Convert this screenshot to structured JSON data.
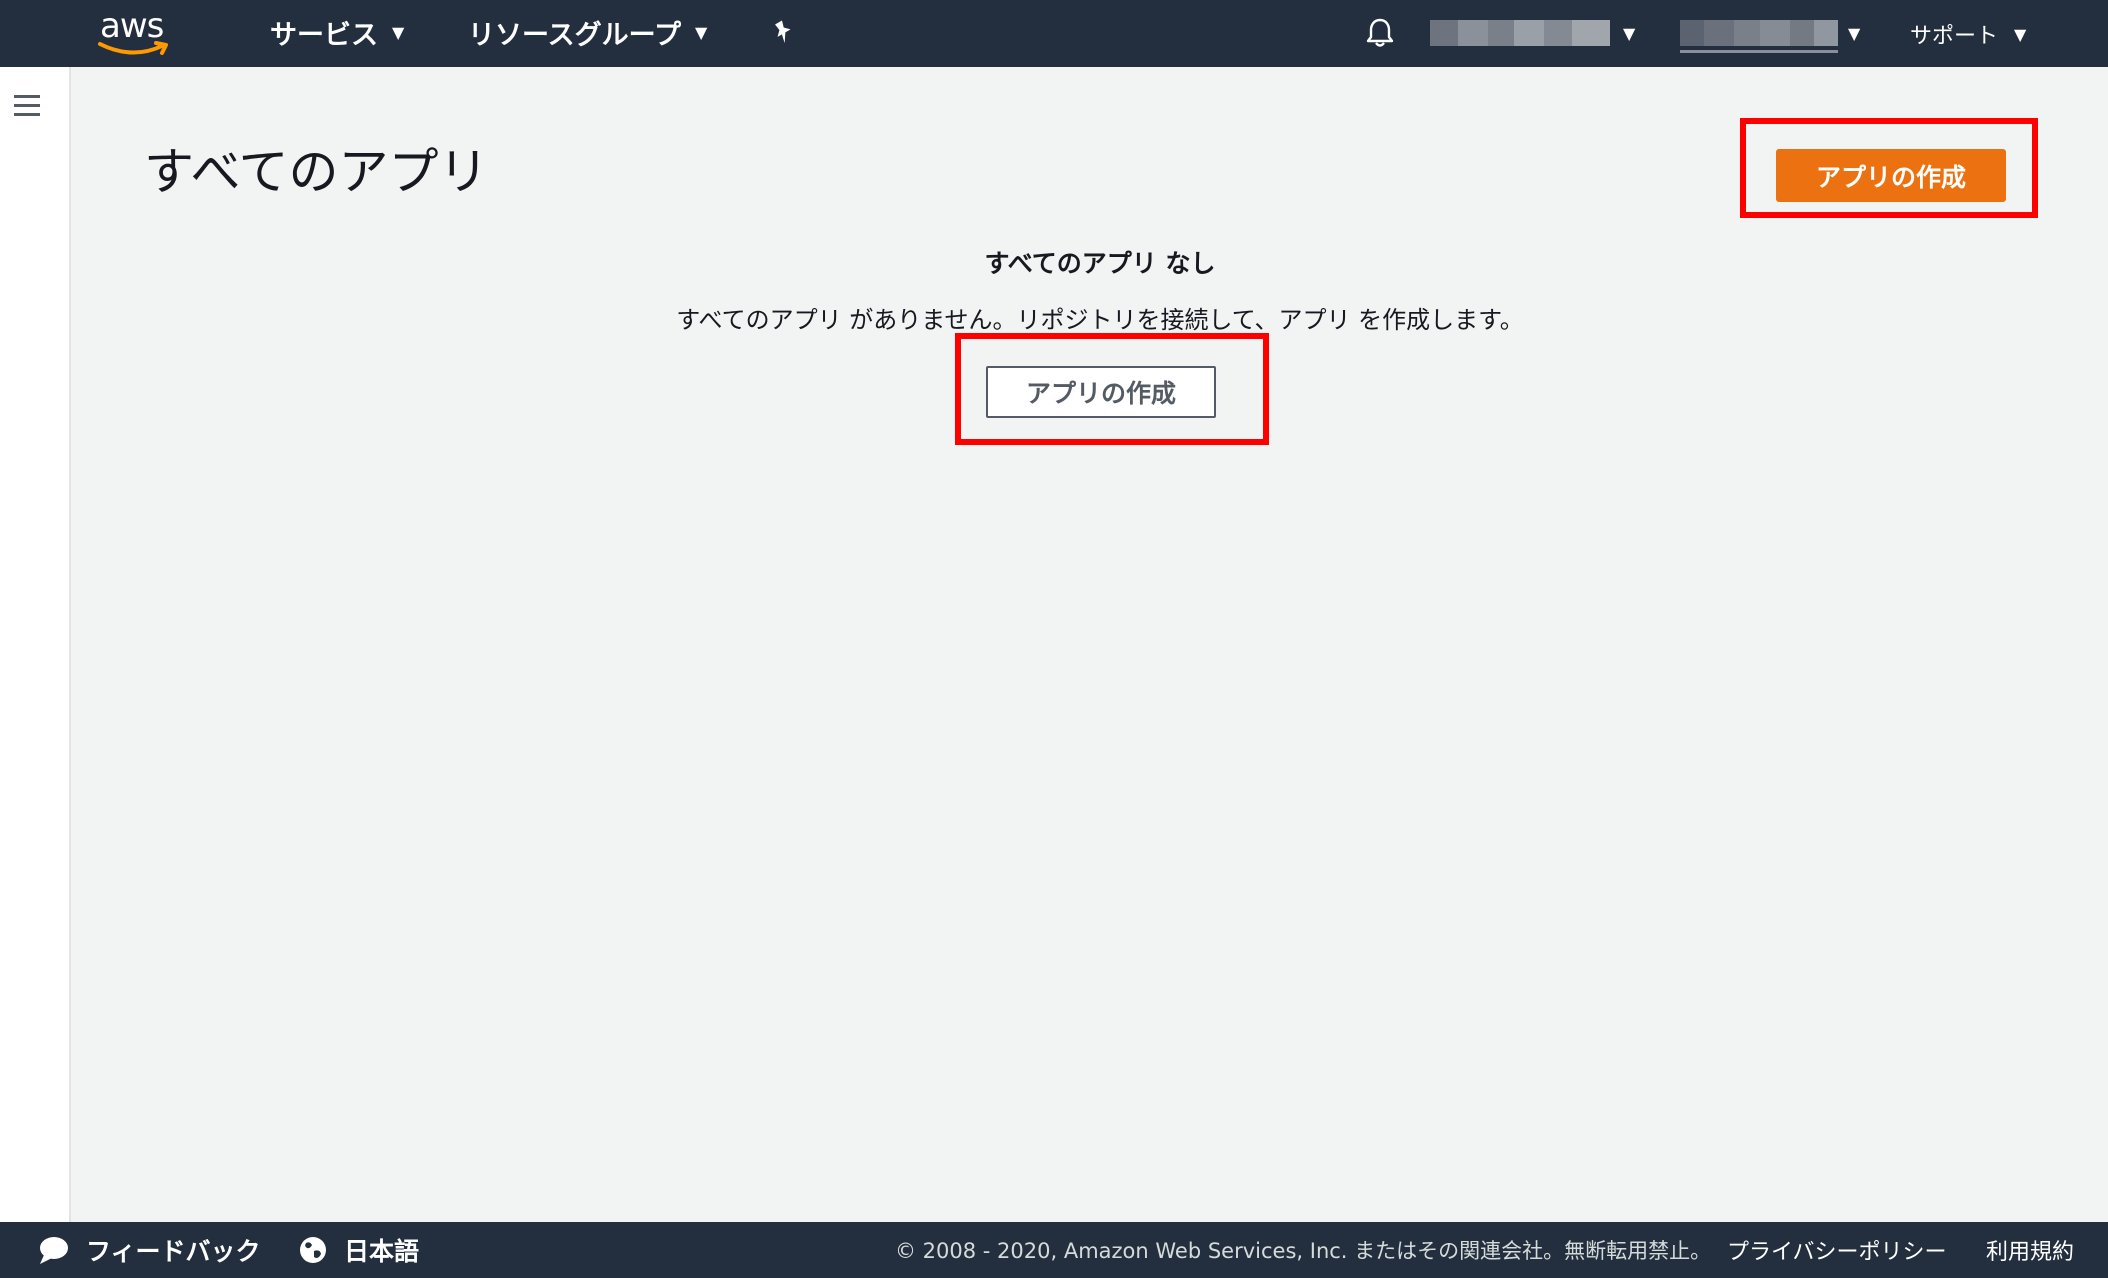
{
  "header": {
    "logo_text": "aws",
    "services_label": "サービス",
    "resource_groups_label": "リソースグループ",
    "support_label": "サポート",
    "caret_glyph": "▼"
  },
  "main": {
    "page_title": "すべてのアプリ",
    "create_app_primary_label": "アプリの作成",
    "empty_state_title": "すべてのアプリ なし",
    "empty_state_text": "すべてのアプリ がありません。リポジトリを接続して、アプリ を作成します。",
    "create_app_secondary_label": "アプリの作成"
  },
  "footer": {
    "feedback_label": "フィードバック",
    "language_label": "日本語",
    "copyright": "© 2008 - 2020, Amazon Web Services, Inc. またはその関連会社。無断転用禁止。",
    "privacy_label": "プライバシーポリシー",
    "terms_label": "利用規約"
  },
  "colors": {
    "nav_bg": "#232f3e",
    "primary_button": "#ec7211",
    "highlight": "#ff0000",
    "page_bg": "#f2f3f3"
  },
  "icons": [
    "aws-logo",
    "pin-icon",
    "bell-icon",
    "hamburger-icon",
    "speech-bubble-icon",
    "globe-icon"
  ]
}
